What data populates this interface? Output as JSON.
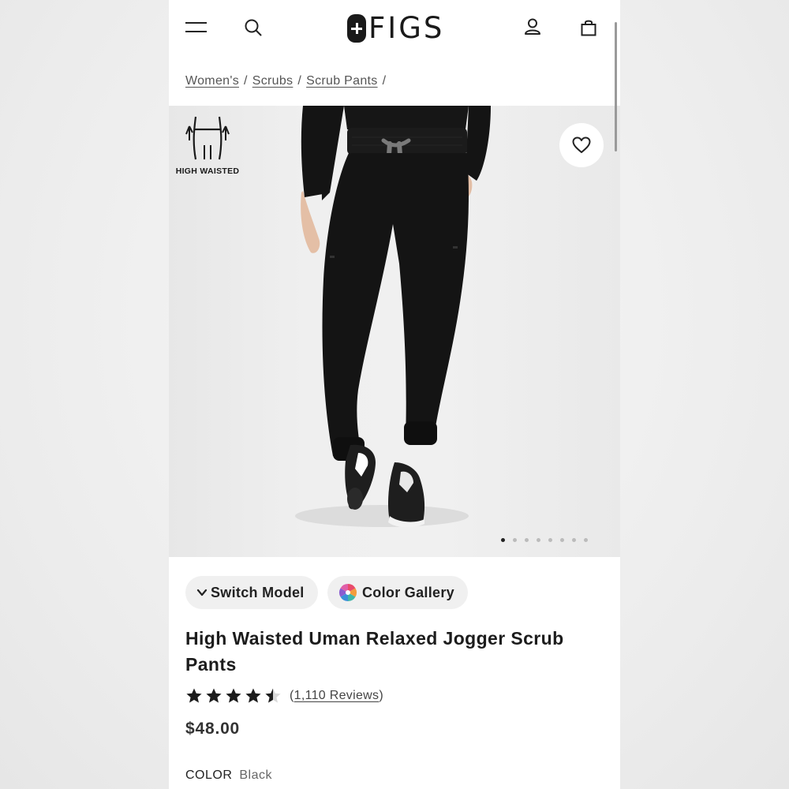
{
  "header": {
    "brand": "FIGS",
    "icons": [
      "menu-icon",
      "search-icon",
      "account-icon",
      "bag-icon"
    ]
  },
  "breadcrumb": {
    "items": [
      "Women's",
      "Scrubs",
      "Scrub Pants"
    ],
    "separator": "/"
  },
  "gallery": {
    "badge_label": "HIGH WAISTED",
    "dot_count": 8,
    "active_dot": 1
  },
  "chips": {
    "switch_model": "Switch Model",
    "color_gallery": "Color Gallery"
  },
  "product": {
    "title": "High Waisted Uman Relaxed Jogger Scrub Pants",
    "rating": 4.5,
    "rating_max": 5,
    "reviews_open": "(",
    "reviews_text": "1,110 Reviews",
    "reviews_close": ")",
    "price": "$48.00",
    "color_label": "COLOR",
    "color_value": "Black"
  },
  "colors": {
    "text": "#1c1c1c",
    "chip_bg": "#f0f0f0",
    "garment": "#141414"
  }
}
